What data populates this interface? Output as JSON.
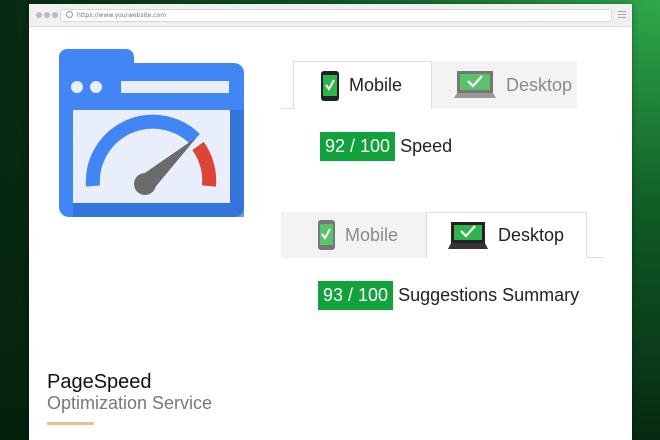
{
  "browser": {
    "url": "https://www.yourwebsite.com"
  },
  "logo": {
    "icon": "pagespeed-speedometer-icon",
    "colors": {
      "blue": "#4285f4",
      "dark_blue": "#2f6dd1",
      "gauge_red": "#db4437",
      "needle": "#6b6b6b"
    }
  },
  "panel1": {
    "tabs": [
      {
        "label": "Mobile",
        "icon": "mobile-phone-check-icon",
        "active": true
      },
      {
        "label": "Desktop",
        "icon": "desktop-monitor-check-icon",
        "active": false
      }
    ],
    "score": "92 / 100",
    "score_label": "Speed"
  },
  "panel2": {
    "tabs": [
      {
        "label": "Mobile",
        "icon": "mobile-phone-check-icon",
        "active": false
      },
      {
        "label": "Desktop",
        "icon": "desktop-monitor-check-icon",
        "active": true
      }
    ],
    "score": "93 / 100",
    "score_label": "Suggestions Summary"
  },
  "footer": {
    "title": "PageSpeed",
    "subtitle": "Optimization Service"
  },
  "colors": {
    "accent_green": "#12a23c",
    "underline": "#f0c08a"
  }
}
